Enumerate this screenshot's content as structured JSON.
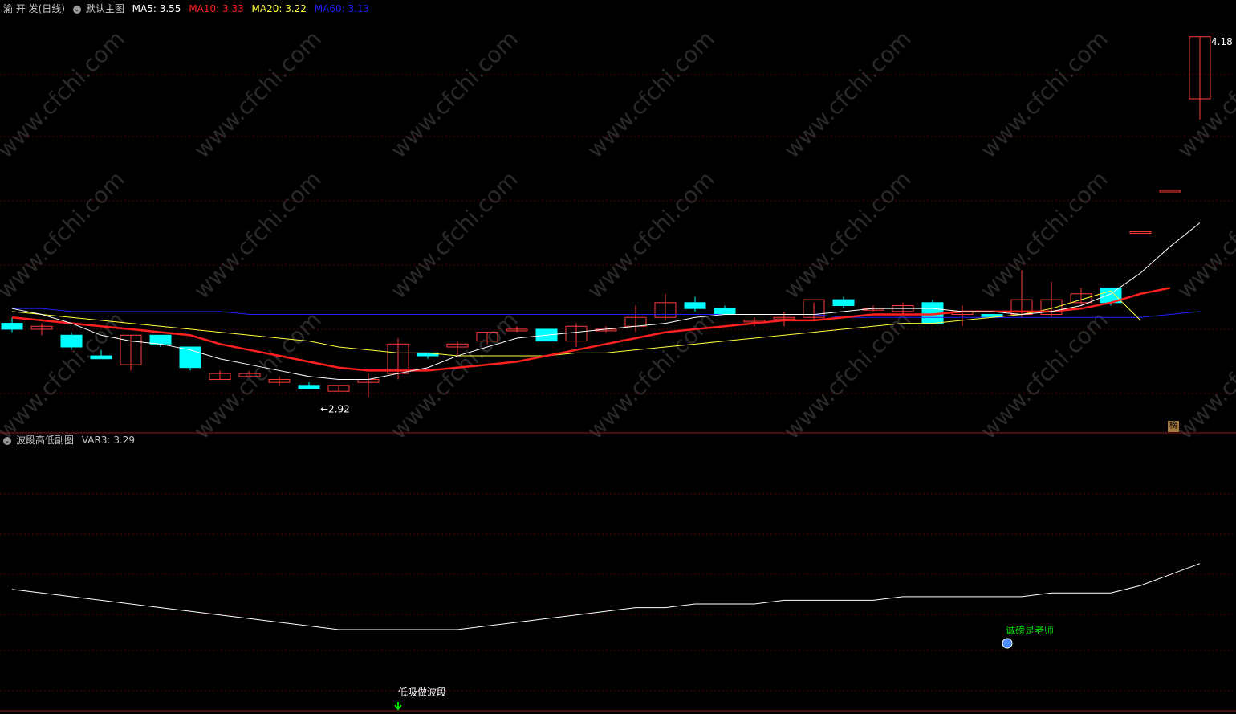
{
  "main_panel": {
    "stock_name": "渝 开 发(日线)",
    "indicator_name": "默认主图",
    "ma5_label": "MA5: 3.55",
    "ma10_label": "MA10: 3.33",
    "ma20_label": "MA20: 3.22",
    "ma60_label": "MA60: 3.13",
    "high_label": "4.18",
    "low_label": "2.92",
    "bang_label": "榜"
  },
  "sub_panel": {
    "indicator_name": "波段高低副图",
    "var3_label": "VAR3: 3.29",
    "buy_signal_label": "低吸做波段",
    "note_label": "诚磅是老师"
  },
  "colors": {
    "up": "#ff3c3c",
    "down": "#00ffff",
    "ma5": "#ffffff",
    "ma10": "#ff2020",
    "ma20": "#ffff3c",
    "ma60": "#2020ff",
    "grid": "#5a0000",
    "divider": "#8b1a1a",
    "buy_arrow": "#00e000",
    "note_text": "#00e000"
  },
  "chart_data": [
    {
      "type": "candlestick",
      "title": "默认主图",
      "ylim": [
        2.85,
        4.25
      ],
      "candles": [
        {
          "o": 3.21,
          "h": 3.23,
          "l": 3.18,
          "c": 3.19
        },
        {
          "o": 3.19,
          "h": 3.21,
          "l": 3.17,
          "c": 3.2
        },
        {
          "o": 3.17,
          "h": 3.18,
          "l": 3.12,
          "c": 3.13
        },
        {
          "o": 3.1,
          "h": 3.12,
          "l": 3.09,
          "c": 3.09
        },
        {
          "o": 3.07,
          "h": 3.17,
          "l": 3.05,
          "c": 3.17
        },
        {
          "o": 3.17,
          "h": 3.17,
          "l": 3.13,
          "c": 3.14
        },
        {
          "o": 3.13,
          "h": 3.13,
          "l": 3.05,
          "c": 3.06
        },
        {
          "o": 3.02,
          "h": 3.05,
          "l": 3.02,
          "c": 3.04
        },
        {
          "o": 3.03,
          "h": 3.05,
          "l": 3.03,
          "c": 3.04
        },
        {
          "o": 3.01,
          "h": 3.03,
          "l": 3.0,
          "c": 3.02
        },
        {
          "o": 3.0,
          "h": 3.01,
          "l": 2.99,
          "c": 2.99
        },
        {
          "o": 2.98,
          "h": 3.0,
          "l": 2.98,
          "c": 3.0
        },
        {
          "o": 3.01,
          "h": 3.04,
          "l": 2.96,
          "c": 3.02
        },
        {
          "o": 3.04,
          "h": 3.16,
          "l": 3.02,
          "c": 3.14
        },
        {
          "o": 3.11,
          "h": 3.11,
          "l": 3.09,
          "c": 3.1
        },
        {
          "o": 3.13,
          "h": 3.15,
          "l": 3.1,
          "c": 3.14
        },
        {
          "o": 3.15,
          "h": 3.18,
          "l": 3.14,
          "c": 3.18
        },
        {
          "o": 3.19,
          "h": 3.2,
          "l": 3.18,
          "c": 3.19
        },
        {
          "o": 3.19,
          "h": 3.19,
          "l": 3.15,
          "c": 3.15
        },
        {
          "o": 3.15,
          "h": 3.21,
          "l": 3.13,
          "c": 3.2
        },
        {
          "o": 3.19,
          "h": 3.2,
          "l": 3.18,
          "c": 3.19
        },
        {
          "o": 3.2,
          "h": 3.27,
          "l": 3.18,
          "c": 3.23
        },
        {
          "o": 3.23,
          "h": 3.31,
          "l": 3.22,
          "c": 3.28
        },
        {
          "o": 3.28,
          "h": 3.3,
          "l": 3.25,
          "c": 3.26
        },
        {
          "o": 3.26,
          "h": 3.27,
          "l": 3.24,
          "c": 3.24
        },
        {
          "o": 3.22,
          "h": 3.23,
          "l": 3.2,
          "c": 3.22
        },
        {
          "o": 3.23,
          "h": 3.25,
          "l": 3.2,
          "c": 3.23
        },
        {
          "o": 3.23,
          "h": 3.28,
          "l": 3.22,
          "c": 3.29
        },
        {
          "o": 3.29,
          "h": 3.3,
          "l": 3.26,
          "c": 3.27
        },
        {
          "o": 3.26,
          "h": 3.27,
          "l": 3.25,
          "c": 3.26
        },
        {
          "o": 3.25,
          "h": 3.28,
          "l": 3.24,
          "c": 3.27
        },
        {
          "o": 3.28,
          "h": 3.29,
          "l": 3.21,
          "c": 3.21
        },
        {
          "o": 3.24,
          "h": 3.27,
          "l": 3.2,
          "c": 3.25
        },
        {
          "o": 3.24,
          "h": 3.24,
          "l": 3.23,
          "c": 3.23
        },
        {
          "o": 3.24,
          "h": 3.39,
          "l": 3.23,
          "c": 3.29
        },
        {
          "o": 3.24,
          "h": 3.35,
          "l": 3.23,
          "c": 3.29
        },
        {
          "o": 3.28,
          "h": 3.33,
          "l": 3.27,
          "c": 3.31
        },
        {
          "o": 3.33,
          "h": 3.33,
          "l": 3.27,
          "c": 3.28
        },
        {
          "o": 3.52,
          "h": 3.52,
          "l": 3.52,
          "c": 3.52
        },
        {
          "o": 3.66,
          "h": 3.66,
          "l": 3.66,
          "c": 3.66
        },
        {
          "o": 3.97,
          "h": 4.18,
          "l": 3.9,
          "c": 4.18
        }
      ],
      "ma5": [
        3.26,
        3.24,
        3.21,
        3.17,
        3.15,
        3.14,
        3.12,
        3.09,
        3.07,
        3.05,
        3.03,
        3.02,
        3.02,
        3.04,
        3.06,
        3.1,
        3.13,
        3.16,
        3.17,
        3.18,
        3.19,
        3.2,
        3.21,
        3.23,
        3.24,
        3.24,
        3.24,
        3.24,
        3.25,
        3.26,
        3.26,
        3.26,
        3.25,
        3.25,
        3.24,
        3.25,
        3.27,
        3.31,
        3.38,
        3.47,
        3.55
      ],
      "ma10": [
        3.23,
        3.22,
        3.21,
        3.2,
        3.19,
        3.18,
        3.17,
        3.14,
        3.12,
        3.1,
        3.08,
        3.06,
        3.05,
        3.05,
        3.05,
        3.06,
        3.07,
        3.08,
        3.1,
        3.12,
        3.14,
        3.16,
        3.18,
        3.19,
        3.2,
        3.21,
        3.22,
        3.22,
        3.23,
        3.24,
        3.24,
        3.24,
        3.25,
        3.25,
        3.25,
        3.25,
        3.26,
        3.28,
        3.31,
        3.33
      ],
      "ma20": [
        3.25,
        3.24,
        3.23,
        3.22,
        3.21,
        3.2,
        3.19,
        3.18,
        3.17,
        3.16,
        3.15,
        3.13,
        3.12,
        3.11,
        3.11,
        3.1,
        3.1,
        3.1,
        3.1,
        3.11,
        3.11,
        3.12,
        3.13,
        3.14,
        3.15,
        3.16,
        3.17,
        3.18,
        3.19,
        3.2,
        3.21,
        3.21,
        3.22,
        3.23,
        3.24,
        3.26,
        3.29,
        3.32,
        3.22
      ],
      "ma60": [
        3.26,
        3.26,
        3.25,
        3.25,
        3.25,
        3.25,
        3.25,
        3.25,
        3.24,
        3.24,
        3.24,
        3.24,
        3.24,
        3.24,
        3.24,
        3.24,
        3.24,
        3.24,
        3.24,
        3.24,
        3.24,
        3.24,
        3.24,
        3.24,
        3.24,
        3.24,
        3.24,
        3.24,
        3.23,
        3.23,
        3.23,
        3.23,
        3.23,
        3.23,
        3.23,
        3.23,
        3.23,
        3.23,
        3.23,
        3.24,
        3.25
      ],
      "annotations": [
        {
          "text": "4.18",
          "type": "high"
        },
        {
          "text": "2.92",
          "type": "low"
        }
      ]
    },
    {
      "type": "line",
      "title": "波段高低副图",
      "series": [
        {
          "name": "VAR3",
          "values": [
            3.22,
            3.21,
            3.2,
            3.19,
            3.18,
            3.17,
            3.16,
            3.15,
            3.14,
            3.13,
            3.12,
            3.11,
            3.11,
            3.11,
            3.11,
            3.11,
            3.12,
            3.13,
            3.14,
            3.15,
            3.16,
            3.17,
            3.17,
            3.18,
            3.18,
            3.18,
            3.19,
            3.19,
            3.19,
            3.19,
            3.2,
            3.2,
            3.2,
            3.2,
            3.2,
            3.21,
            3.21,
            3.21,
            3.23,
            3.26,
            3.29
          ]
        }
      ],
      "ylim": [
        2.9,
        3.6
      ],
      "annotations": [
        {
          "text": "低吸做波段",
          "index": 13
        },
        {
          "text": "诚磅是老师",
          "index": 33
        }
      ]
    }
  ]
}
